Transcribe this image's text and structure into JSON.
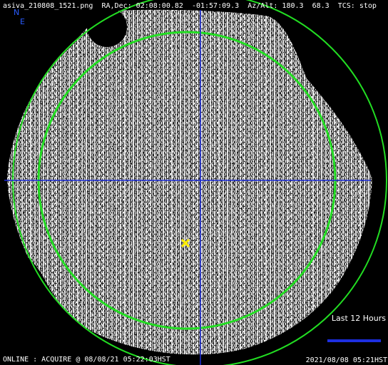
{
  "header": {
    "filename": "asiva_210808_1521.png",
    "radec_label": "RA,Dec:",
    "ra": "02:08:00.82",
    "dec": "-01:57:09.3",
    "azalt_label": "Az/Alt:",
    "az": "180.3",
    "alt": "68.3",
    "tcs_label": "TCS:",
    "tcs_status": "stop"
  },
  "compass": {
    "north": "N",
    "east": "E"
  },
  "history": {
    "label": "Last 12 Hours"
  },
  "status_bar": {
    "status": "ONLINE : ACQUIRE @ 08/08/21 05:22:03HST",
    "image_timestamp": "2021/08/08 05:21HST"
  },
  "colors": {
    "background": "#000000",
    "sky_light": "#ffffff",
    "circle": "#22dd22",
    "crosshair": "#1a2bd8",
    "target_marker": "#ffee00",
    "compass": "#2a5cff",
    "history_bar": "#1d2fe0",
    "text": "#ffffff"
  },
  "markers": {
    "target": "target-cross-icon"
  }
}
